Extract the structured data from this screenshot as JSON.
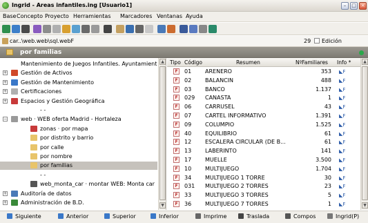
{
  "window": {
    "title": "Ingrid - Areas infantiles.ing  [Usuario1]",
    "minimize": "–",
    "maximize": "□",
    "close": "×"
  },
  "menu": [
    "Base",
    "Concepto",
    "Proyecto",
    "Herramientas",
    "Marcadores",
    "Ventanas",
    "Ayuda"
  ],
  "toolbar_icons": [
    "save-icon",
    "open-icon",
    "print-icon",
    "settings-icon",
    "cut-icon",
    "undo-icon",
    "filter-icon",
    "table-icon",
    "grid-icon",
    "report-icon",
    "tools-icon",
    "copy-icon",
    "printer-icon",
    "export-icon",
    "image-icon",
    "query-icon",
    "chart-icon",
    "layout-icon",
    "globe-icon",
    "wand-icon",
    "calc-icon"
  ],
  "path": {
    "text": "car..\\web.web\\sql.webF",
    "record": "29",
    "edit_label": "Edición"
  },
  "section": {
    "title": "por familias"
  },
  "tree": [
    {
      "label": "Mantenimiento de Juegos Infantiles. Ayuntamient",
      "level": 0,
      "expander": "",
      "icon": "",
      "selected": false
    },
    {
      "label": "Gestión de Activos",
      "level": 0,
      "expander": "+",
      "icon": "assets-icon",
      "selected": false
    },
    {
      "label": "Gestión de Mantenimiento",
      "level": 0,
      "expander": "+",
      "icon": "maintenance-icon",
      "selected": false
    },
    {
      "label": "Certificaciones",
      "level": 0,
      "expander": "+",
      "icon": "certificate-icon",
      "selected": false
    },
    {
      "label": "Espacios y Gestión Geográfica",
      "level": 0,
      "expander": "+",
      "icon": "map-icon",
      "selected": false
    },
    {
      "label": "- -",
      "level": 1,
      "expander": "",
      "icon": "",
      "selected": false
    },
    {
      "label": "web · WEB oferta Madrid - Hortaleza",
      "level": 0,
      "expander": "−",
      "icon": "web-icon",
      "selected": false
    },
    {
      "label": "zonas · por mapa",
      "level": 1,
      "expander": "",
      "icon": "map-icon",
      "selected": false
    },
    {
      "label": "por distrito y barrio",
      "level": 1,
      "expander": "",
      "icon": "folder-icon",
      "selected": false
    },
    {
      "label": "por calle",
      "level": 1,
      "expander": "",
      "icon": "folder-icon",
      "selected": false
    },
    {
      "label": "por nombre",
      "level": 1,
      "expander": "",
      "icon": "folder-icon",
      "selected": false
    },
    {
      "label": "por familias",
      "level": 1,
      "expander": "",
      "icon": "folder-icon",
      "selected": true
    },
    {
      "label": "- -",
      "level": 1,
      "expander": "",
      "icon": "",
      "selected": false
    },
    {
      "label": "web_monta_car · montar WEB: Monta car",
      "level": 1,
      "expander": "",
      "icon": "pencil-icon",
      "selected": false
    },
    {
      "label": "Auditoría de datos",
      "level": 0,
      "expander": "+",
      "icon": "audit-icon",
      "selected": false
    },
    {
      "label": "Administración de B.D.",
      "level": 0,
      "expander": "+",
      "icon": "admin-icon",
      "selected": false
    }
  ],
  "table": {
    "headers": [
      "Tipo",
      "Código",
      "Resumen",
      "NºFamiliares",
      "Info *"
    ],
    "rows": [
      {
        "tipo": "F",
        "codigo": "01",
        "resumen": "ARENERO",
        "familiares": "353",
        "info": "◣F"
      },
      {
        "tipo": "F",
        "codigo": "02",
        "resumen": "BALANCIN",
        "familiares": "488",
        "info": "◣F"
      },
      {
        "tipo": "F",
        "codigo": "03",
        "resumen": "BANCO",
        "familiares": "1.137",
        "info": "◣F"
      },
      {
        "tipo": "F",
        "codigo": "029",
        "resumen": "CANASTA",
        "familiares": "1",
        "info": "◣F"
      },
      {
        "tipo": "F",
        "codigo": "06",
        "resumen": "CARRUSEL",
        "familiares": "43",
        "info": "◣F"
      },
      {
        "tipo": "F",
        "codigo": "07",
        "resumen": "CARTEL INFORMATIVO",
        "familiares": "1.391",
        "info": "◣F"
      },
      {
        "tipo": "F",
        "codigo": "09",
        "resumen": "COLUMPIO",
        "familiares": "1.525",
        "info": "◣F"
      },
      {
        "tipo": "F",
        "codigo": "40",
        "resumen": "EQUILIBRIO",
        "familiares": "61",
        "info": "◣F"
      },
      {
        "tipo": "F",
        "codigo": "12",
        "resumen": "ESCALERA CIRCULAR (DE B...",
        "familiares": "61",
        "info": "◣F"
      },
      {
        "tipo": "F",
        "codigo": "13",
        "resumen": "LABERINTO",
        "familiares": "141",
        "info": "◣F"
      },
      {
        "tipo": "F",
        "codigo": "17",
        "resumen": "MUELLE",
        "familiares": "3.500",
        "info": "◣F"
      },
      {
        "tipo": "F",
        "codigo": "10",
        "resumen": "MULTIJUEGO",
        "familiares": "1.704",
        "info": "◣F"
      },
      {
        "tipo": "F",
        "codigo": "34",
        "resumen": "MULTIJUEGO 1 TORRE",
        "familiares": "30",
        "info": "◣F"
      },
      {
        "tipo": "F",
        "codigo": "031",
        "resumen": "MULTIJUEGO 2 TORRES",
        "familiares": "23",
        "info": "◣F"
      },
      {
        "tipo": "F",
        "codigo": "33",
        "resumen": "MULTIJUEGO 3 TORRES",
        "familiares": "5",
        "info": "◣F"
      },
      {
        "tipo": "F",
        "codigo": "36",
        "resumen": "MULTIJUEGO 7 TORRES",
        "familiares": "1",
        "info": "◣F"
      }
    ]
  },
  "bottom_buttons": [
    {
      "label": "Siguiente",
      "icon": "next-icon"
    },
    {
      "label": "Anterior",
      "icon": "previous-icon"
    },
    {
      "label": "Superior",
      "icon": "up-icon"
    },
    {
      "label": "Inferior",
      "icon": "down-icon"
    },
    {
      "label": "Imprime",
      "icon": "print-icon"
    },
    {
      "label": "Traslada",
      "icon": "move-icon"
    },
    {
      "label": "Compos",
      "icon": "compose-icon"
    },
    {
      "label": "Ingrid(P)",
      "icon": "ingrid-icon"
    }
  ],
  "colors": {
    "accent": "#2a5aa8",
    "selection": "#c6c2bc",
    "section_bg": "#8a877f"
  }
}
